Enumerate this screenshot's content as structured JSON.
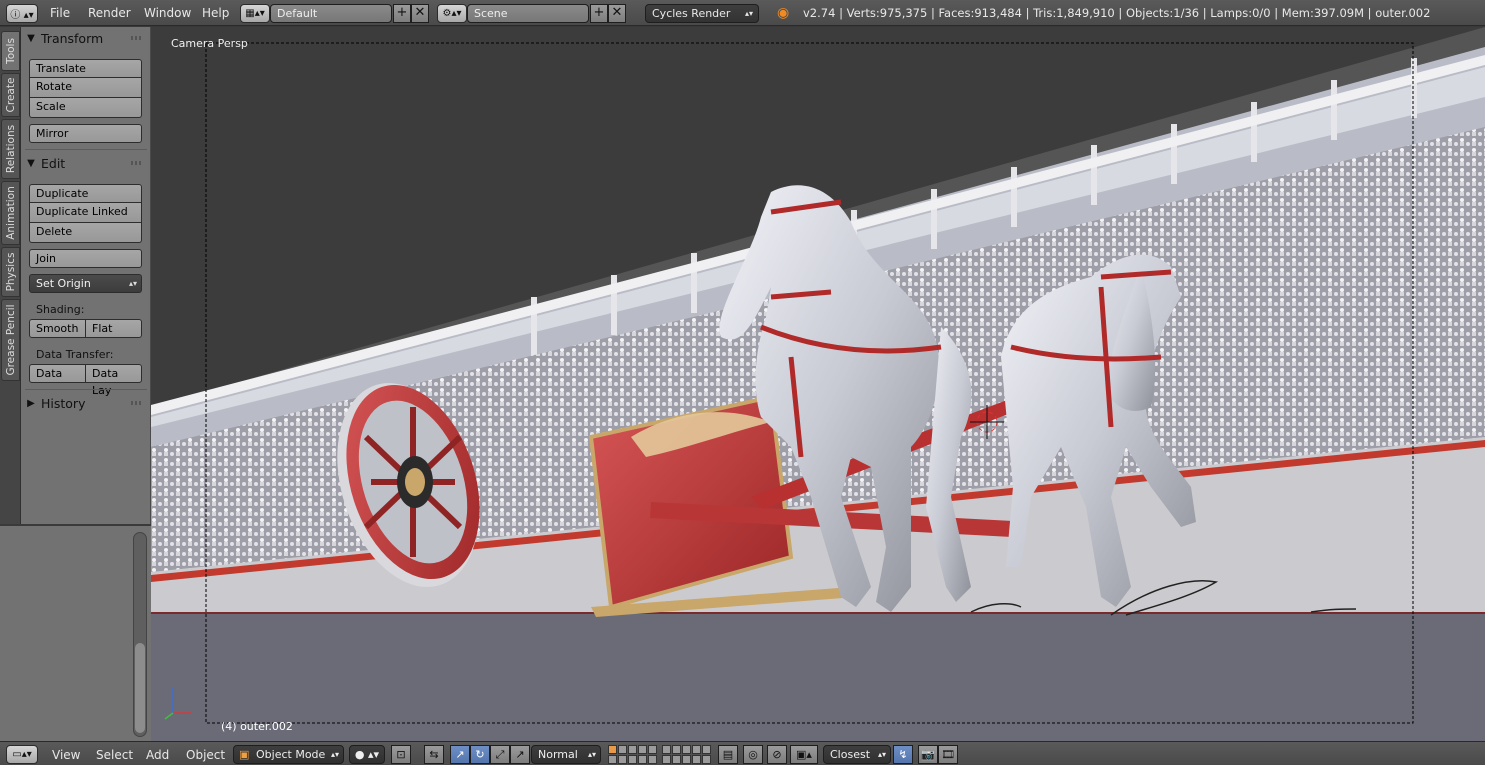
{
  "topbar": {
    "menus": [
      "File",
      "Render",
      "Window",
      "Help"
    ],
    "screen_layout": "Default",
    "scene": "Scene",
    "render_engine": "Cycles Render",
    "stats": "v2.74 | Verts:975,375 | Faces:913,484 | Tris:1,849,910 | Objects:1/36 | Lamps:0/0 | Mem:397.09M | outer.002"
  },
  "tool_tabs": [
    "Tools",
    "Create",
    "Relations",
    "Animation",
    "Physics",
    "Grease Pencil"
  ],
  "tool_shelf": {
    "transform": {
      "title": "Transform",
      "translate": "Translate",
      "rotate": "Rotate",
      "scale": "Scale",
      "mirror": "Mirror"
    },
    "edit": {
      "title": "Edit",
      "duplicate": "Duplicate",
      "duplicate_linked": "Duplicate Linked",
      "delete": "Delete",
      "join": "Join",
      "set_origin": "Set Origin",
      "shading_label": "Shading:",
      "smooth": "Smooth",
      "flat": "Flat",
      "data_transfer_label": "Data Transfer:",
      "data": "Data",
      "data_lay": "Data Lay"
    },
    "history": {
      "title": "History"
    }
  },
  "viewport": {
    "view_name": "Camera Persp",
    "active_object": "(4) outer.002"
  },
  "bottombar": {
    "menus": [
      "View",
      "Select",
      "Add",
      "Object"
    ],
    "mode": "Object Mode",
    "orientation": "Normal",
    "snap_target": "Closest"
  },
  "colors": {
    "chariot_red": "#c23a3a",
    "horse_silver": "#d4d6de",
    "arena_wall": "#c8c8c8",
    "ground": "#6b6b77",
    "accent_blue": "#5475ad"
  }
}
